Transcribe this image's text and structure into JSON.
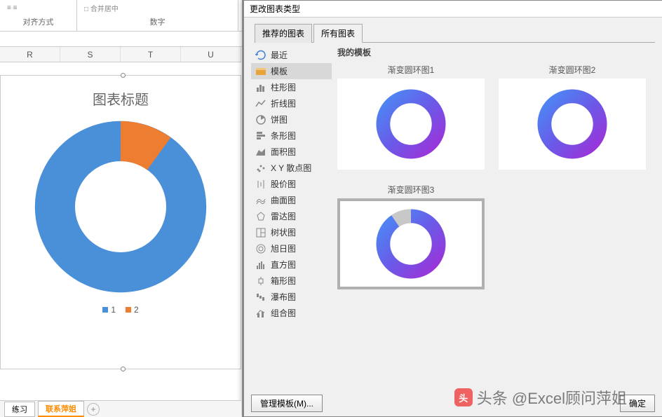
{
  "ribbon": {
    "group_align": "对齐方式",
    "group_number": "数字",
    "stub_merge": "□ 合并居中"
  },
  "columns": [
    "R",
    "S",
    "T",
    "U"
  ],
  "chart": {
    "title": "图表标题",
    "legend": [
      {
        "label": "1",
        "color": "#4a90d9"
      },
      {
        "label": "2",
        "color": "#ed7d31"
      }
    ]
  },
  "chart_data": {
    "type": "pie",
    "categories": [
      "1",
      "2"
    ],
    "values": [
      90,
      10
    ],
    "title": "图表标题",
    "style": "doughnut",
    "colors": [
      "#4a90d9",
      "#ed7d31"
    ]
  },
  "dialog": {
    "title": "更改图表类型",
    "tabs": {
      "recommended": "推荐的图表",
      "all": "所有图表"
    },
    "active_tab": "all",
    "categories": [
      {
        "icon": "recent",
        "label": "最近"
      },
      {
        "icon": "template",
        "label": "模板"
      },
      {
        "icon": "column",
        "label": "柱形图"
      },
      {
        "icon": "line",
        "label": "折线图"
      },
      {
        "icon": "pie",
        "label": "饼图"
      },
      {
        "icon": "bar",
        "label": "条形图"
      },
      {
        "icon": "area",
        "label": "面积图"
      },
      {
        "icon": "scatter",
        "label": "X Y 散点图"
      },
      {
        "icon": "stock",
        "label": "股价图"
      },
      {
        "icon": "surface",
        "label": "曲面图"
      },
      {
        "icon": "radar",
        "label": "雷达图"
      },
      {
        "icon": "treemap",
        "label": "树状图"
      },
      {
        "icon": "sunburst",
        "label": "旭日图"
      },
      {
        "icon": "histogram",
        "label": "直方图"
      },
      {
        "icon": "boxwhisker",
        "label": "箱形图"
      },
      {
        "icon": "waterfall",
        "label": "瀑布图"
      },
      {
        "icon": "combo",
        "label": "组合图"
      }
    ],
    "selected_category": 1,
    "panel_header": "我的模板",
    "templates": [
      {
        "label": "渐变圆环图1"
      },
      {
        "label": "渐变圆环图2"
      },
      {
        "label": "渐变圆环图3"
      }
    ],
    "selected_template": 2,
    "manage_btn": "管理模板(M)...",
    "ok_btn": "确定"
  },
  "sheets": {
    "tabs": [
      "练习",
      "联系萍姐"
    ],
    "active": 1
  },
  "watermark": "头条 @Excel顾问萍姐"
}
